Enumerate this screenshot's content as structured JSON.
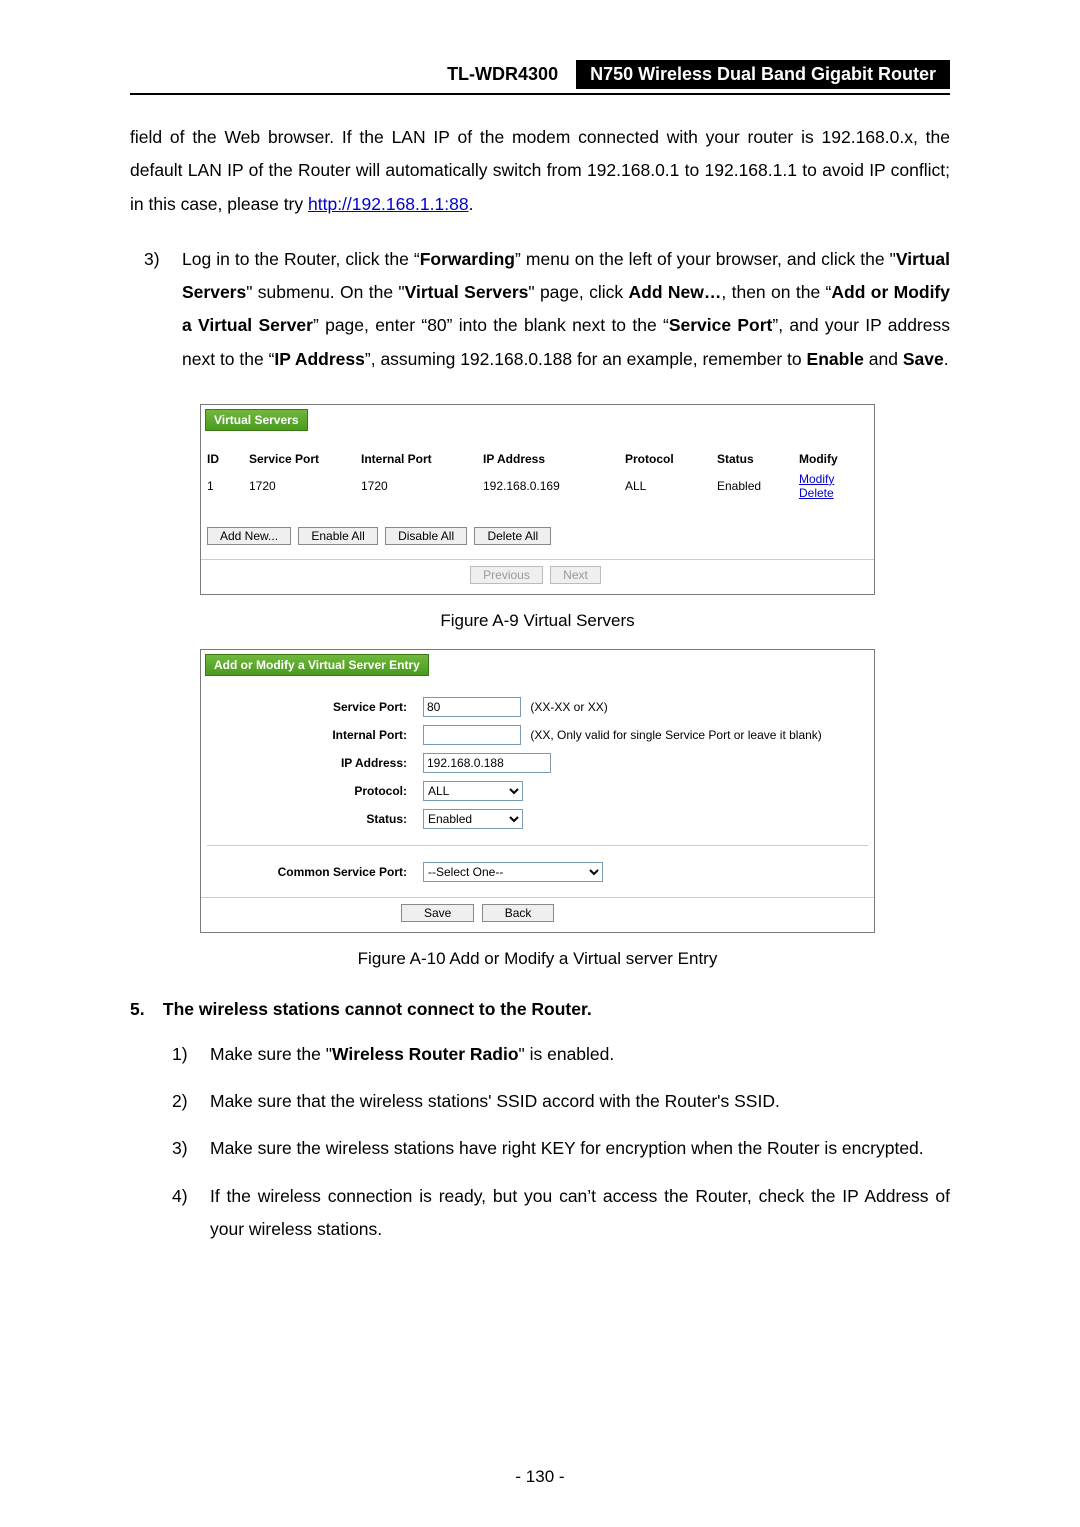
{
  "header": {
    "model": "TL-WDR4300",
    "product": "N750 Wireless Dual Band Gigabit Router"
  },
  "intro": {
    "line1_a": "field of the Web browser. If the LAN IP of the modem connected with your router is 192.168.0.x, the default LAN IP of the Router will automatically switch from 192.168.0.1 to 192.168.1.1 to avoid IP conflict; in this case, please try ",
    "link": "http://192.168.1.1:88",
    "line1_b": "."
  },
  "step3": {
    "num": "3)",
    "t1": "Log in to the Router, click the “",
    "b1": "Forwarding",
    "t2": "” menu on the left of your browser, and click the \"",
    "b2": "Virtual Servers",
    "t3": "\" submenu. On the \"",
    "b3": "Virtual Servers",
    "t4": "\" page, click ",
    "b4": "Add New…",
    "t5": ", then on the “",
    "b5": "Add or Modify a Virtual Server",
    "t6": "” page, enter “80” into the blank next to the “",
    "b6": "Service Port",
    "t7": "”, and your IP address next to the “",
    "b7": "IP Address",
    "t8": "”, assuming 192.168.0.188 for an example, remember to ",
    "b8": "Enable",
    "t9": " and ",
    "b9": "Save",
    "t10": "."
  },
  "vs": {
    "title": "Virtual Servers",
    "cols": {
      "id": "ID",
      "sp": "Service Port",
      "ip_col": "Internal Port",
      "ipaddr": "IP Address",
      "proto": "Protocol",
      "status": "Status",
      "mod": "Modify"
    },
    "row": {
      "id": "1",
      "sp": "1720",
      "ip": "1720",
      "ipaddr": "192.168.0.169",
      "proto": "ALL",
      "status": "Enabled",
      "modl": "Modify",
      "dell": "Delete"
    },
    "btns": {
      "add": "Add New...",
      "ena": "Enable All",
      "dis": "Disable All",
      "del": "Delete All",
      "prev": "Previous",
      "next": "Next"
    }
  },
  "cap1": "Figure A-9 Virtual Servers",
  "form": {
    "title": "Add or Modify a Virtual Server Entry",
    "labels": {
      "sp": "Service Port:",
      "ip": "Internal Port:",
      "ipaddr": "IP Address:",
      "proto": "Protocol:",
      "status": "Status:",
      "csp": "Common Service Port:"
    },
    "values": {
      "sp": "80",
      "ip": "",
      "ipaddr": "192.168.0.188",
      "proto": "ALL",
      "status": "Enabled",
      "csp": "--Select One--"
    },
    "hints": {
      "sp": "(XX-XX or XX)",
      "ip": "(XX, Only valid for single Service Port or leave it blank)"
    },
    "btns": {
      "save": "Save",
      "back": "Back"
    }
  },
  "cap2": "Figure A-10 Add or Modify a Virtual server Entry",
  "q5": {
    "num": "5.",
    "text": "The wireless stations cannot connect to the Router."
  },
  "sub": {
    "i1n": "1)",
    "i1a": "Make sure the \"",
    "i1b": "Wireless Router Radio",
    "i1c": "\" is enabled.",
    "i2n": "2)",
    "i2t": "Make sure that the wireless stations' SSID accord with the Router's SSID.",
    "i3n": "3)",
    "i3t": "Make sure the wireless stations have right KEY for encryption when the Router is encrypted.",
    "i4n": "4)",
    "i4t": "If the wireless connection is ready, but you can’t access the Router, check the IP Address of your wireless stations."
  },
  "page_no": "- 130 -"
}
